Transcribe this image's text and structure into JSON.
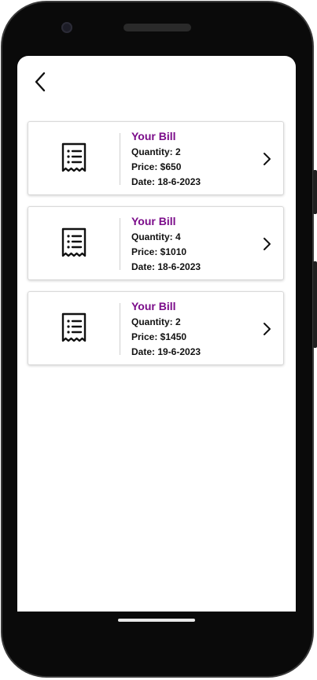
{
  "header": {
    "back_icon": "chevron-left-icon"
  },
  "bills": [
    {
      "title": "Your Bill",
      "quantity": "Quantity: 2",
      "price": "Price: $650",
      "date": "Date: 18-6-2023"
    },
    {
      "title": "Your Bill",
      "quantity": "Quantity: 4",
      "price": "Price: $1010",
      "date": "Date: 18-6-2023"
    },
    {
      "title": "Your Bill",
      "quantity": "Quantity: 2",
      "price": "Price: $1450",
      "date": "Date: 19-6-2023"
    }
  ],
  "icons": {
    "bill": "receipt-icon",
    "open": "chevron-right-icon"
  },
  "colors": {
    "accent": "#7b0c8a",
    "text": "#111111",
    "card_border": "#d9d9d9"
  }
}
